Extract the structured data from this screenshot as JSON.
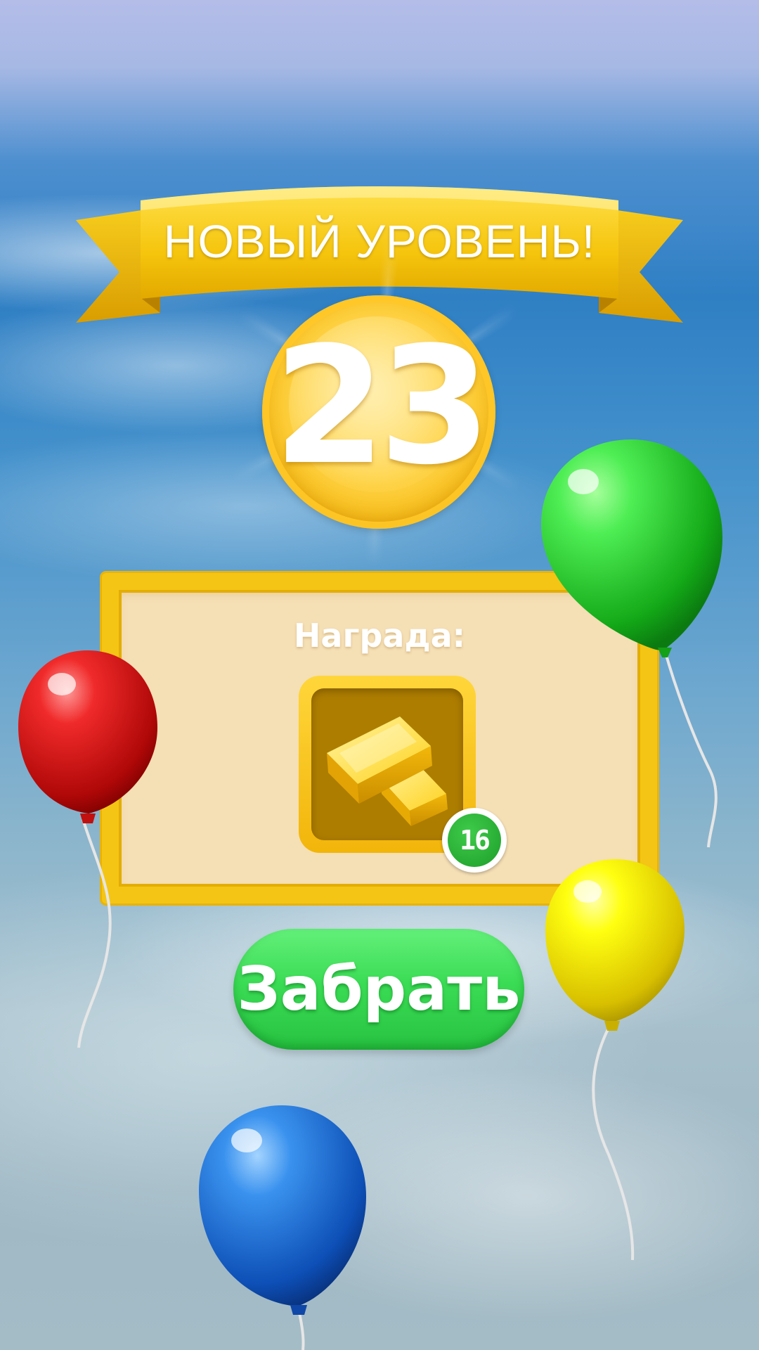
{
  "banner": {
    "title": "НОВЫЙ УРОВЕНЬ!"
  },
  "level": {
    "number": "23"
  },
  "reward": {
    "title": "Награда:",
    "item_icon": "gold-bars-icon",
    "count": "16"
  },
  "actions": {
    "claim_label": "Забрать"
  },
  "decorations": {
    "balloons": [
      "green",
      "red",
      "yellow",
      "blue"
    ]
  },
  "colors": {
    "gold": "#f4c514",
    "panel": "#f5dfb5",
    "button_green": "#3bdc55",
    "badge_green": "#1e9e2a"
  }
}
